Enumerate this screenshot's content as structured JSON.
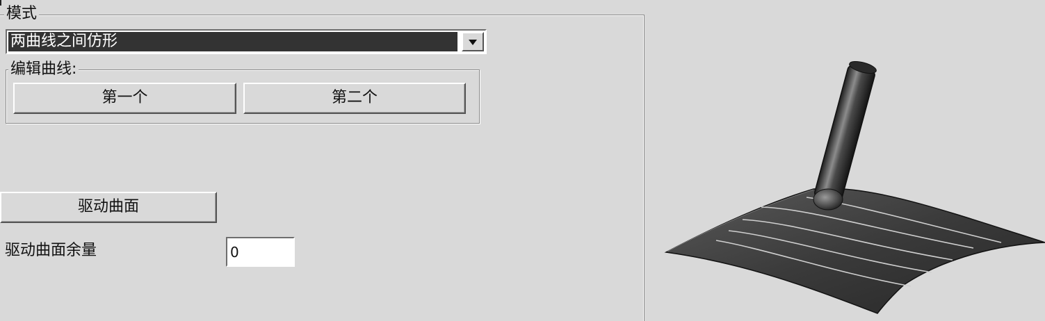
{
  "mode_group": {
    "legend": "模式",
    "mode_select": {
      "value": "两曲线之间仿形"
    }
  },
  "edit_curves": {
    "legend": "编辑曲线:",
    "first_button": "第一个",
    "second_button": "第二个"
  },
  "drive_surface": {
    "button": "驱动曲面",
    "allowance_label": "驱动曲面余量",
    "allowance_value": "0"
  },
  "colors": {
    "dialog_background": "#d9d9d9",
    "selection_background": "#333333",
    "surface_fill": "#3a3a3a",
    "flowline_color": "#cfcfcf"
  },
  "preview": {
    "icon": "surface-with-tool-preview"
  }
}
